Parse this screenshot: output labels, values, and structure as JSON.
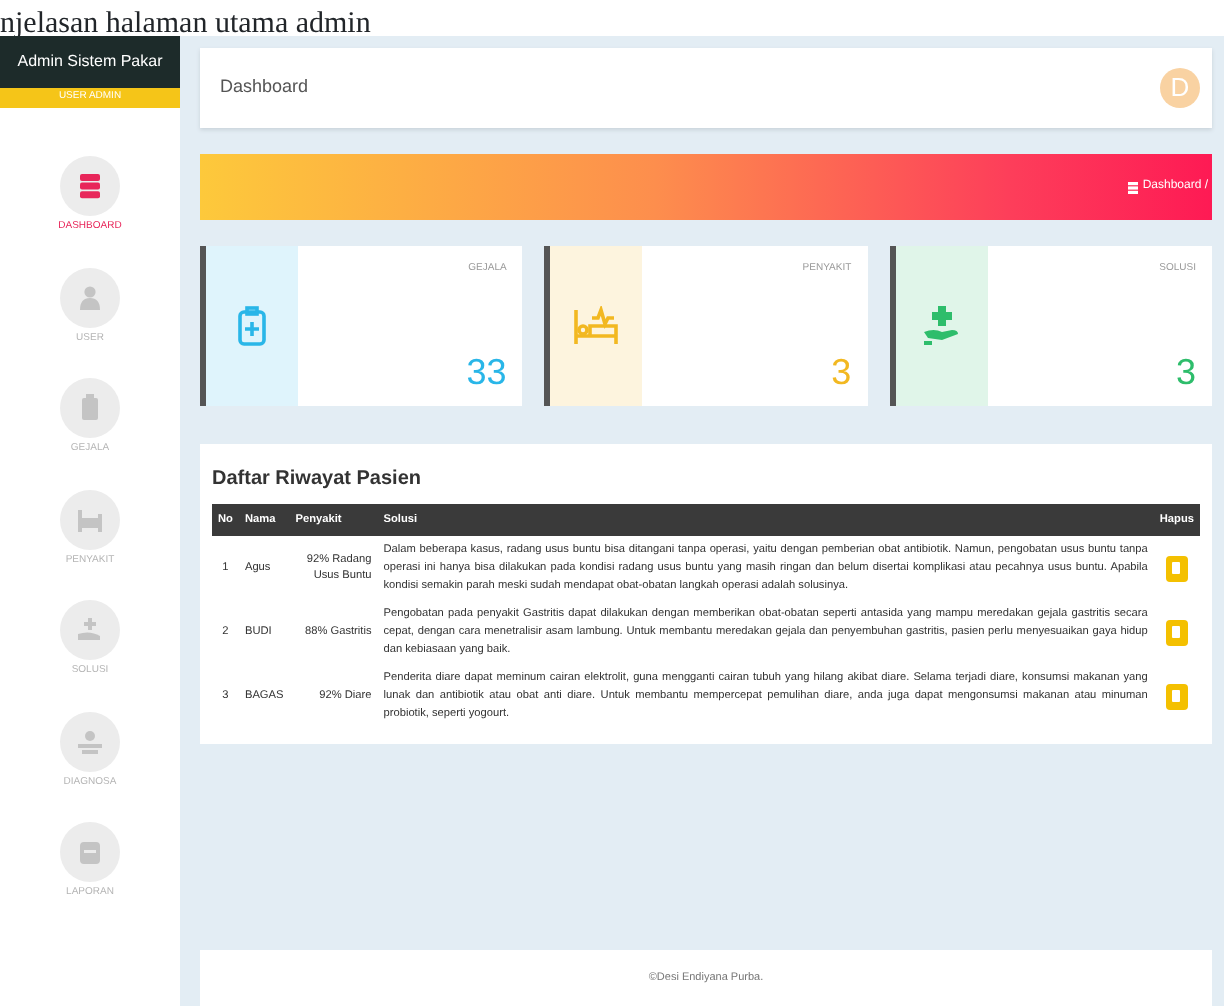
{
  "caption": "njelasan halaman utama admin",
  "sidebar": {
    "title": "Admin Sistem Pakar",
    "role": "USER ADMIN",
    "items": [
      {
        "label": "DASHBOARD",
        "selected": true
      },
      {
        "label": "USER",
        "selected": false
      },
      {
        "label": "GEJALA",
        "selected": false
      },
      {
        "label": "PENYAKIT",
        "selected": false
      },
      {
        "label": "SOLUSI",
        "selected": false
      },
      {
        "label": "DIAGNOSA",
        "selected": false
      },
      {
        "label": "LAPORAN",
        "selected": false
      }
    ]
  },
  "topbar": {
    "title": "Dashboard",
    "avatar": "D"
  },
  "breadcrumb": "Dashboard /",
  "stats": [
    {
      "label": "GEJALA",
      "value": "33",
      "color": "#29b6e8"
    },
    {
      "label": "PENYAKIT",
      "value": "3",
      "color": "#f2b821"
    },
    {
      "label": "SOLUSI",
      "value": "3",
      "color": "#2ebd6b"
    }
  ],
  "table": {
    "title": "Daftar Riwayat Pasien",
    "columns": [
      "No",
      "Nama",
      "Penyakit",
      "Solusi",
      "Hapus"
    ],
    "rows": [
      {
        "no": "1",
        "nama": "Agus",
        "penyakit": "92% Radang Usus Buntu",
        "solusi": "Dalam beberapa kasus, radang usus buntu bisa ditangani tanpa operasi, yaitu dengan pemberian obat antibiotik. Namun, pengobatan usus buntu tanpa operasi ini hanya bisa dilakukan pada kondisi radang usus buntu yang masih ringan dan belum disertai komplikasi atau pecahnya usus buntu. Apabila kondisi semakin parah meski sudah mendapat obat-obatan langkah operasi adalah solusinya."
      },
      {
        "no": "2",
        "nama": "BUDI",
        "penyakit": "88% Gastritis",
        "solusi": "Pengobatan pada penyakit Gastritis dapat dilakukan dengan memberikan obat-obatan seperti antasida yang mampu meredakan gejala gastritis secara cepat, dengan cara menetralisir asam lambung. Untuk membantu meredakan gejala dan penyembuhan gastritis, pasien perlu menyesuaikan gaya hidup dan kebiasaan yang baik."
      },
      {
        "no": "3",
        "nama": "BAGAS",
        "penyakit": "92% Diare",
        "solusi": "Penderita diare dapat meminum cairan elektrolit, guna mengganti cairan tubuh yang hilang akibat diare. Selama terjadi diare, konsumsi makanan yang lunak dan antibiotik atau obat anti diare. Untuk membantu mempercepat pemulihan diare, anda juga dapat mengonsumsi makanan atau minuman probiotik, seperti yogourt."
      }
    ]
  },
  "footer": "©Desi Endiyana Purba."
}
